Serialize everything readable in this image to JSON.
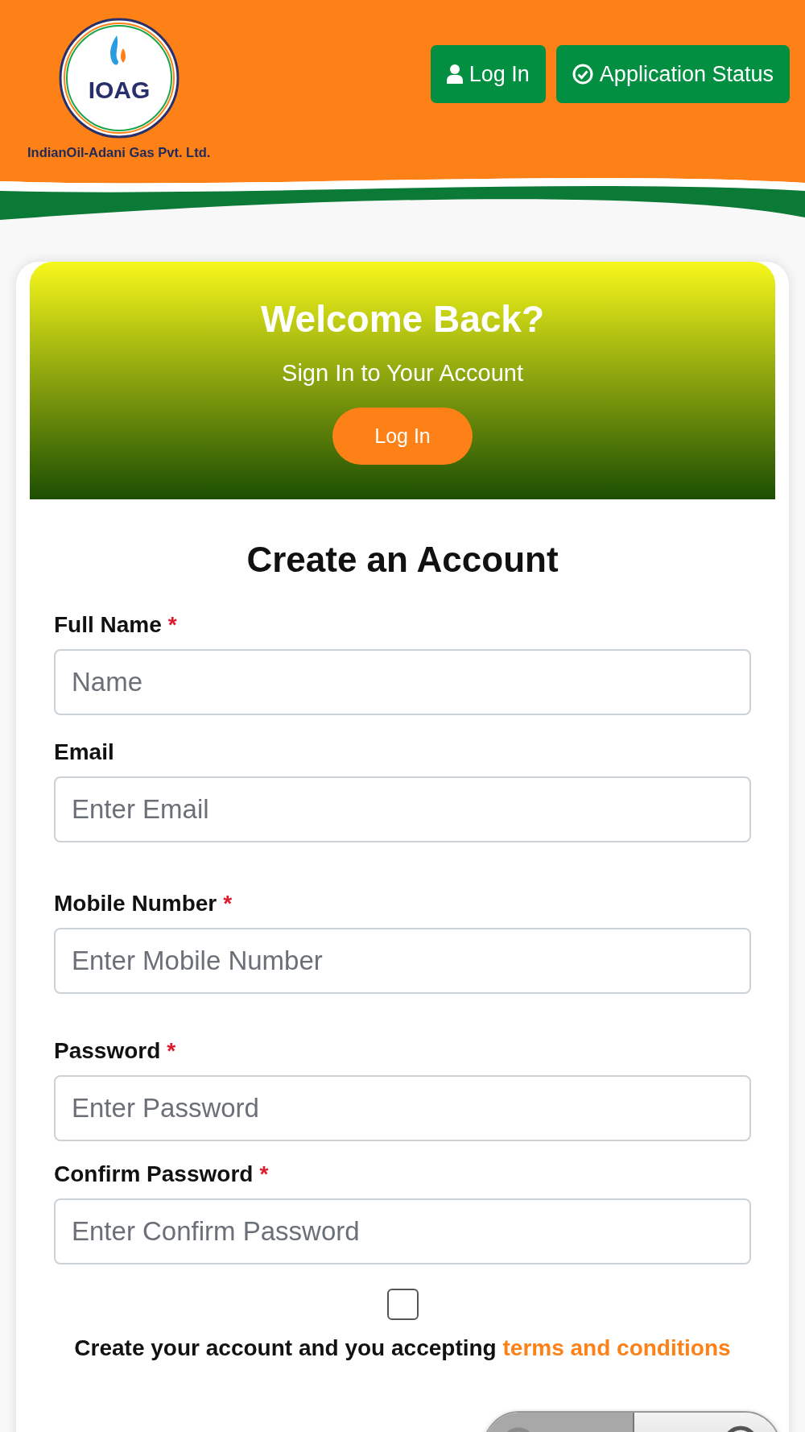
{
  "header": {
    "logo_text": "IOAG",
    "company": "IndianOil-Adani Gas Pvt. Ltd.",
    "buttons": [
      {
        "label": "Log In"
      },
      {
        "label": "Application Status"
      }
    ]
  },
  "banner": {
    "title": "Welcome Back?",
    "subtitle": "Sign In to Your Account",
    "button": "Log In"
  },
  "form": {
    "title": "Create an Account",
    "fields": [
      {
        "label": "Full Name",
        "required_mark": "*",
        "placeholder": "Name"
      },
      {
        "label": "Email",
        "placeholder": "Enter Email"
      },
      {
        "label": "Mobile Number",
        "required_mark": "*",
        "placeholder": "Enter Mobile Number"
      },
      {
        "label": "Password",
        "required_mark": "*",
        "placeholder": "Enter Password"
      },
      {
        "label": "Confirm Password",
        "required_mark": "*",
        "placeholder": "Enter Confirm Password"
      }
    ],
    "terms": {
      "checked": false,
      "text": "Create your account and you accepting",
      "link": "terms and conditions"
    }
  }
}
